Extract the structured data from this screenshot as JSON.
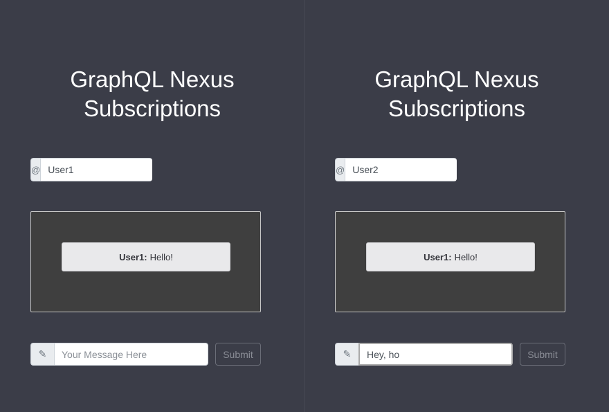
{
  "panes": [
    {
      "title_line1": "GraphQL Nexus",
      "title_line2": "Subscriptions",
      "username_prefix": "@",
      "username_value": "User1",
      "messages": [
        {
          "author": "User1:",
          "text": "Hello!"
        }
      ],
      "compose_icon": "✎",
      "compose_value": "",
      "compose_placeholder": "Your Message Here",
      "submit_label": "Submit"
    },
    {
      "title_line1": "GraphQL Nexus",
      "title_line2": "Subscriptions",
      "username_prefix": "@",
      "username_value": "User2",
      "messages": [
        {
          "author": "User1:",
          "text": "Hello!"
        }
      ],
      "compose_icon": "✎",
      "compose_value": "Hey, ho",
      "compose_placeholder": "Your Message Here",
      "submit_label": "Submit"
    }
  ],
  "icons": {
    "username_prefix": "at-icon",
    "compose_icon": "pencil-icon"
  }
}
